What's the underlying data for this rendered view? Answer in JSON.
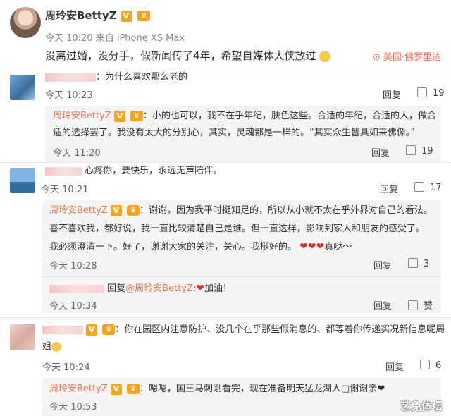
{
  "post": {
    "author": "周玲安BettyZ",
    "meta": "今天 10:20 来自 iPhone XS Max",
    "text": "没离过婚，没分手，假新闻传了4年，希望自媒体大侠放过",
    "location": "美国·佛罗里达"
  },
  "labels": {
    "reply": "回复",
    "praise": "赞",
    "verified_badge": "V"
  },
  "comments": [
    {
      "text": "：为什么喜欢那么老的",
      "time": "今天 10:23",
      "likes": "19"
    },
    {
      "text": "心疼你，要快乐，永远无声陪伴。",
      "time": "今天 10:21",
      "likes": "17"
    },
    {
      "text": "：你在园区内注意防护、没几个在乎那些假消息的、都等着你传递实况新信息呢周",
      "text2": "姐",
      "time": "今天 10:24",
      "likes": "6"
    }
  ],
  "replies": [
    {
      "name": "周玲安BettyZ",
      "line1": "：小的也可以，我不在乎年纪，肤色这些。合适的年纪，合适的人，做合",
      "line2": "适的选择罢了。我没有太大的分别心，其实，灵魂都是一样的。“其实众生皆具如来佛像。”",
      "time": "今天 11:20",
      "likes": "19"
    },
    {
      "name": "周玲安BettyZ",
      "line1": "：谢谢，因为我平时挺知足的，所以从小就不太在乎外界对自己的看法。",
      "line2": "喜不喜欢我，都好说，我一直比较清楚自己是谁。但一直这样，影响到家人和朋友的感受了。",
      "line3": "我必须澄清一下。好了，谢谢大家的关注，关心。我挺好的。",
      "line3b": "真哒～",
      "time": "今天 10:28",
      "likes": "3"
    },
    {
      "prefix": "回复",
      "mention": "@周玲安BettyZ",
      "text": ":",
      "text2": "加油！",
      "time": "今天 10:34"
    },
    {
      "name": "周玲安BettyZ",
      "line1": "：嗯嗯，国王马刺刚看完，现在准备明天猛龙湖人□谢谢亲❤",
      "time": "今天 10:53"
    }
  ],
  "watermark": "艺免体坛"
}
